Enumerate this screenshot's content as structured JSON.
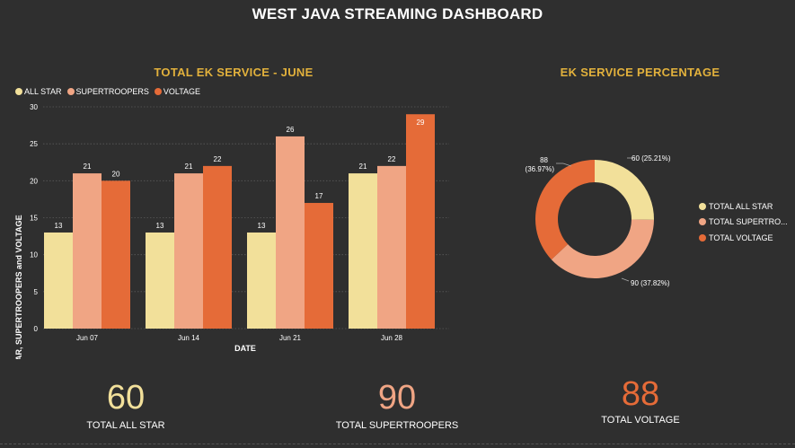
{
  "dashboard": {
    "title": "WEST JAVA STREAMING DASHBOARD"
  },
  "colors": {
    "all_star": "#f2e09a",
    "supertroopers": "#f0a584",
    "voltage": "#e56b38",
    "title_accent": "#e2b13c",
    "background": "#2f2f2f"
  },
  "chart_data": [
    {
      "type": "bar",
      "title": "TOTAL EK SERVICE - JUNE",
      "xlabel": "DATE",
      "ylabel": "ALL STAR, SUPERTROOPERS and VOLTAGE",
      "categories": [
        "Jun 07",
        "Jun 14",
        "Jun 21",
        "Jun 28"
      ],
      "series": [
        {
          "name": "ALL STAR",
          "values": [
            13,
            13,
            13,
            21
          ]
        },
        {
          "name": "SUPERTROOPERS",
          "values": [
            21,
            21,
            26,
            22
          ]
        },
        {
          "name": "VOLTAGE",
          "values": [
            20,
            22,
            17,
            29
          ]
        }
      ],
      "ylim": [
        0,
        30
      ],
      "yticks": [
        "0",
        "5",
        "10",
        "15",
        "20",
        "25",
        "30"
      ],
      "grid": true,
      "legend_position": "top-left"
    },
    {
      "type": "pie",
      "title": "EK SERVICE PERCENTAGE",
      "labels": [
        "TOTAL ALL STAR",
        "TOTAL SUPERTRO..."
      ],
      "legend_extra": "TOTAL VOLTAGE",
      "values": [
        60,
        90,
        88
      ],
      "data_labels": [
        "60 (25.21%)",
        "90 (37.82%)",
        "88",
        "(36.97%)"
      ],
      "donut": true,
      "legend_position": "right"
    }
  ],
  "kpis": [
    {
      "value": "60",
      "label": "TOTAL ALL STAR"
    },
    {
      "value": "90",
      "label": "TOTAL SUPERTROOPERS"
    },
    {
      "value": "88",
      "label": "TOTAL VOLTAGE"
    }
  ]
}
